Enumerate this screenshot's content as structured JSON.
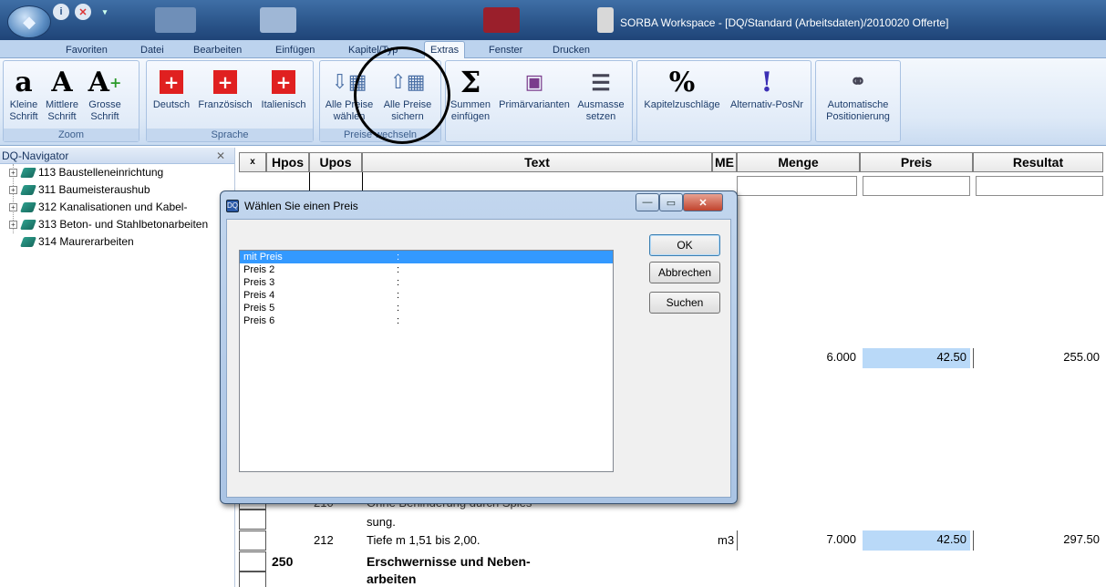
{
  "window": {
    "title": "SORBA Workspace - [DQ/Standard (Arbeitsdaten)/2010020 Offerte]"
  },
  "tabs": [
    "Favoriten",
    "Datei",
    "Bearbeiten",
    "Einfügen",
    "Kapitel/Typ",
    "Extras",
    "Fenster",
    "Drucken"
  ],
  "active_tab": "Extras",
  "ribbon": {
    "zoom": {
      "label": "Zoom",
      "small": "Kleine\nSchrift",
      "medium": "Mittlere\nSchrift",
      "large": "Grosse\nSchrift"
    },
    "sprache": {
      "label": "Sprache",
      "de": "Deutsch",
      "fr": "Französisch",
      "it": "Italienisch"
    },
    "preise": {
      "label": "Preise wechseln",
      "waehlen": "Alle Preise\nwählen",
      "sichern": "Alle Preise\nsichern"
    },
    "summen": "Summen\neinfügen",
    "primaer": "Primärvarianten",
    "ausmasse": "Ausmasse\nsetzen",
    "kapzu": "Kapitelzuschläge",
    "alternativ": "Alternativ-PosNr",
    "auto": "Automatische\nPositionierung"
  },
  "navigator": {
    "title": "DQ-Navigator",
    "items": [
      "113 Baustelleneinrichtung",
      "311 Baumeisteraushub",
      "312 Kanalisationen und Kabel-",
      "313 Beton- und Stahlbetonarbeiten",
      "314 Maurerarbeiten"
    ]
  },
  "grid": {
    "headers": {
      "x": "x",
      "hpos": "Hpos",
      "upos": "Upos",
      "text": "Text",
      "me": "ME",
      "menge": "Menge",
      "preis": "Preis",
      "resultat": "Resultat"
    },
    "row1": {
      "menge": "6.000",
      "preis": "42.50",
      "resultat": "255.00"
    },
    "partial_text_1": "Ohne Behinderung durch Spies-",
    "partial_upos": "210",
    "partial_text_2": "sung.",
    "row2": {
      "upos": "212",
      "text": "Tiefe m 1,51 bis 2,00.",
      "me": "m3",
      "menge": "7.000",
      "preis": "42.50",
      "resultat": "297.50"
    },
    "row3": {
      "hpos": "250",
      "text_line1": "Erschwernisse und Neben-",
      "text_line2": "arbeiten"
    }
  },
  "dialog": {
    "title": "Wählen Sie einen Preis",
    "options": [
      "mit Preis",
      "Preis 2",
      "Preis 3",
      "Preis 4",
      "Preis 5",
      "Preis 6"
    ],
    "selected": "mit Preis",
    "ok": "OK",
    "cancel": "Abbrechen",
    "search": "Suchen",
    "colon": ":"
  },
  "colors": {
    "accent": "#3399ff",
    "price_bg": "#b9d9f8",
    "titlebar": "#2a5489"
  }
}
